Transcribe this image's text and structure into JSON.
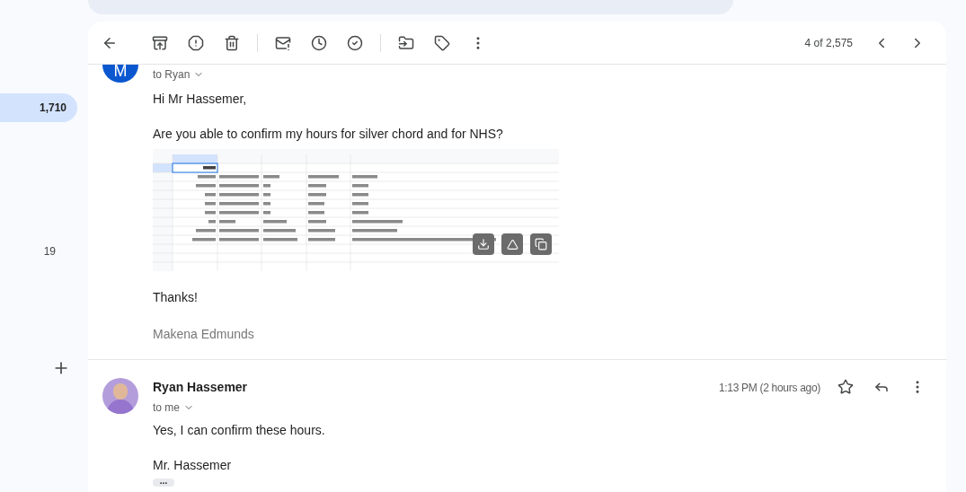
{
  "sidebar": {
    "counts": [
      {
        "label": "1,710",
        "selected": true
      },
      {
        "label": "19",
        "selected": false
      }
    ]
  },
  "toolbar": {
    "page_info": "4 of 2,575"
  },
  "messages": [
    {
      "avatar_letter": "M",
      "recipient": "to Ryan",
      "greeting": "Hi Mr Hassemer,",
      "body": "Are you able to confirm my hours for silver chord and for NHS?",
      "closing": "Thanks!",
      "signature": "Makena Edmunds"
    },
    {
      "sender": "Ryan Hassemer",
      "recipient": "to me",
      "time": "1:13 PM (2 hours ago)",
      "body": "Yes, I can confirm these hours.",
      "signature": "Mr. Hassemer"
    }
  ]
}
